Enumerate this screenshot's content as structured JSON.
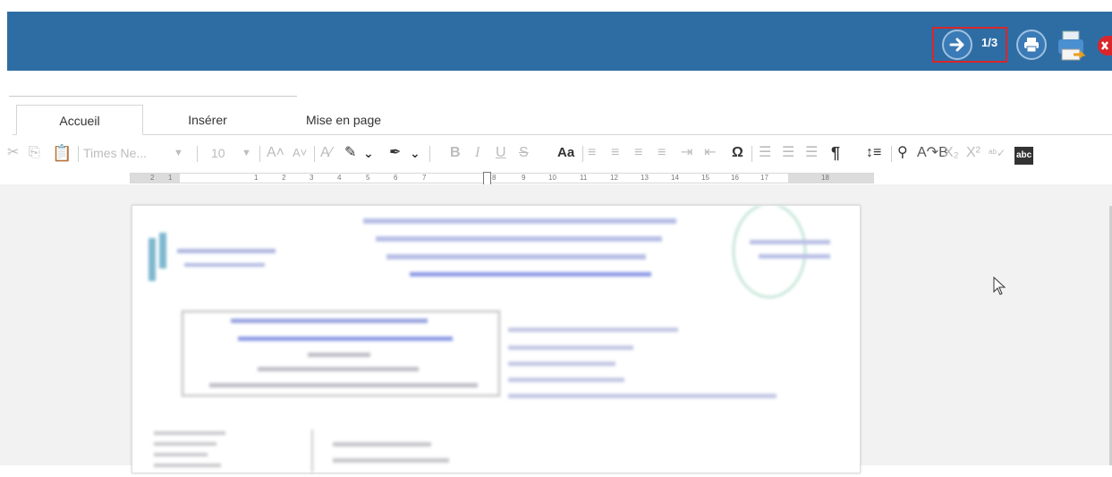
{
  "header": {
    "page_indicator": "1/3",
    "colors": {
      "bar": "#2e6da4",
      "highlight": "#d9262a",
      "close": "#d9262a"
    }
  },
  "tabs": [
    {
      "label": "Accueil",
      "active": true
    },
    {
      "label": "Insérer",
      "active": false
    },
    {
      "label": "Mise en page",
      "active": false
    }
  ],
  "toolbar": {
    "font_name": "Times Ne...",
    "font_size": "10",
    "case_label": "Aa",
    "omega_label": "Ω",
    "pilcrow_label": "¶"
  },
  "ruler": {
    "labels": [
      "2",
      "1",
      "1",
      "2",
      "3",
      "4",
      "5",
      "6",
      "7",
      "8",
      "9",
      "10",
      "11",
      "12",
      "13",
      "14",
      "15",
      "16",
      "17",
      "18"
    ]
  }
}
